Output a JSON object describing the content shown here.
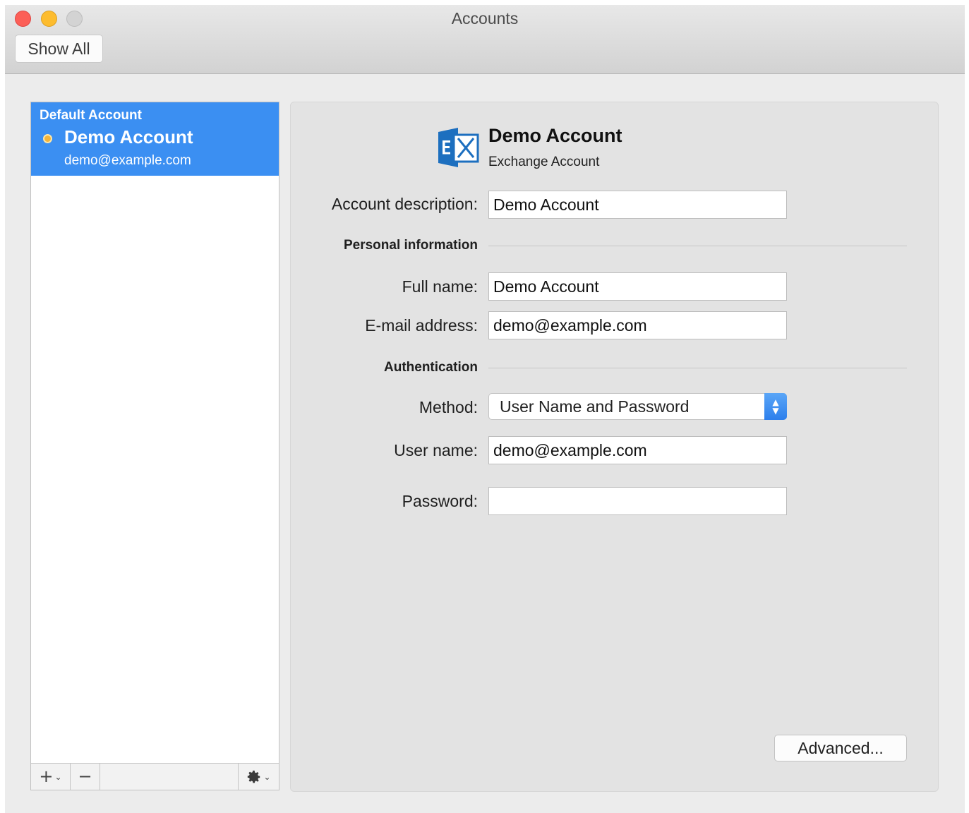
{
  "window": {
    "title": "Accounts",
    "show_all_label": "Show All"
  },
  "sidebar": {
    "group_label": "Default Account",
    "account_name": "Demo Account",
    "account_email": "demo@example.com",
    "toolbar": {
      "add": "+",
      "remove": "−",
      "gear": "gear-icon"
    }
  },
  "detail": {
    "header_name": "Demo Account",
    "header_type": "Exchange Account",
    "account_description_label": "Account description:",
    "account_description_value": "Demo Account",
    "personal_section": "Personal information",
    "full_name_label": "Full name:",
    "full_name_value": "Demo Account",
    "email_label": "E-mail address:",
    "email_value": "demo@example.com",
    "auth_section": "Authentication",
    "method_label": "Method:",
    "method_value": "User Name and Password",
    "username_label": "User name:",
    "username_value": "demo@example.com",
    "password_label": "Password:",
    "password_value": "",
    "advanced_label": "Advanced..."
  },
  "colors": {
    "selection": "#3b8ff2",
    "exchange_blue": "#1d6fbf"
  }
}
